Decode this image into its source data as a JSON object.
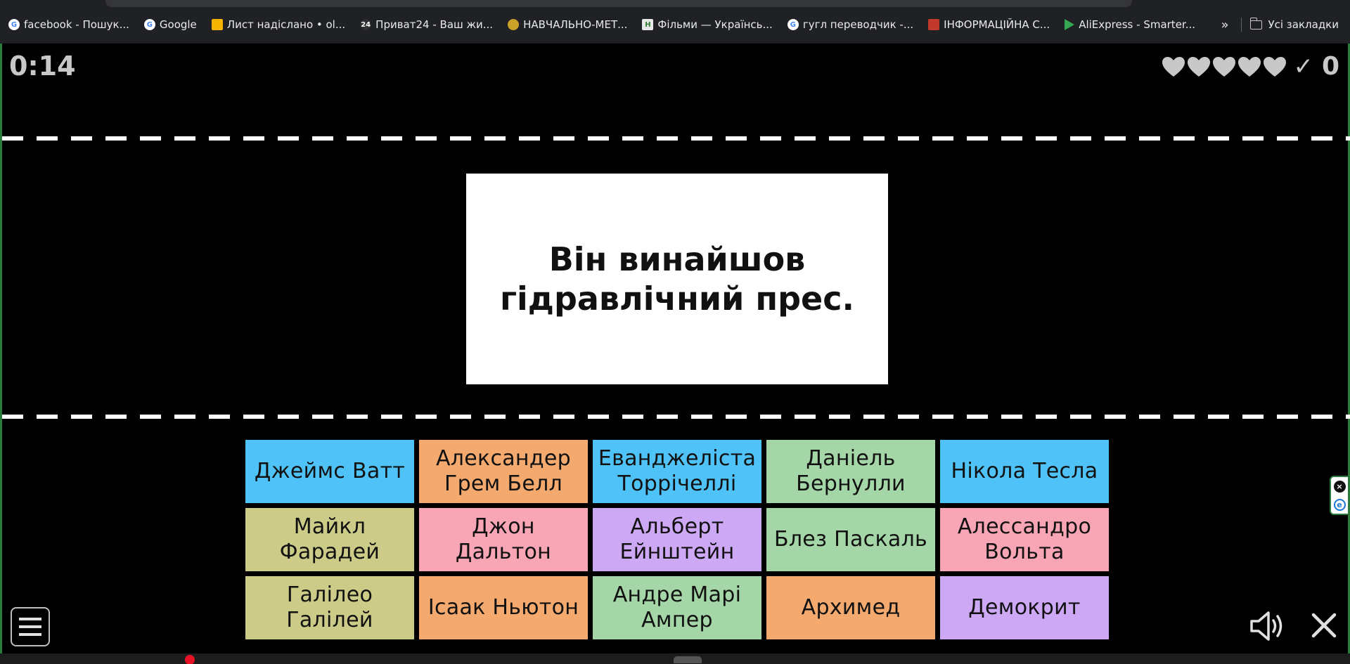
{
  "bookmarks": {
    "items": [
      {
        "label": "facebook - Пошук...",
        "icon": "google-icon",
        "color": "#4285f4"
      },
      {
        "label": "Google",
        "icon": "google-icon",
        "color": "#4285f4"
      },
      {
        "label": "Лист надіслано • ol...",
        "icon": "docs-icon",
        "color": "#f4b400"
      },
      {
        "label": "Приват24 - Ваш жи...",
        "icon": "privat24-icon",
        "color": "#2f2f2f"
      },
      {
        "label": "НАВЧАЛЬНО-МЕТ...",
        "icon": "emblem-icon",
        "color": "#c9a227"
      },
      {
        "label": "Фільми — Українсь...",
        "icon": "films-icon",
        "color": "#e8e8e8"
      },
      {
        "label": "гугл переводчик -...",
        "icon": "google-icon",
        "color": "#4285f4"
      },
      {
        "label": "ІНФОРМАЦІЙНА С...",
        "icon": "book-icon",
        "color": "#c0392b"
      },
      {
        "label": "AliExpress - Smarter...",
        "icon": "play-icon",
        "color": "#34a853"
      }
    ],
    "more": "»",
    "all_bookmarks": "Усі закладки"
  },
  "game": {
    "timer": "0:14",
    "lives": 5,
    "check": "✓",
    "score": "0",
    "question": "Він винайшов гідравлічний прес.",
    "answers": [
      {
        "label": "Джеймс Ватт",
        "color": "#4fc3f7"
      },
      {
        "label": "Александер Грем Белл",
        "color": "#f4a96e"
      },
      {
        "label": "Еванджеліста Торрічеллі",
        "color": "#4fc3f7"
      },
      {
        "label": "Даніель Бернулли",
        "color": "#a5d6a7"
      },
      {
        "label": "Нікола Тесла",
        "color": "#4fc3f7"
      },
      {
        "label": "Майкл Фарадей",
        "color": "#cccc88"
      },
      {
        "label": "Джон Дальтон",
        "color": "#f8a5b5"
      },
      {
        "label": "Альберт Ейнштейн",
        "color": "#cda8f5"
      },
      {
        "label": "Блез Паскаль",
        "color": "#a5d6a7"
      },
      {
        "label": "Алессандро Вольта",
        "color": "#f8a5b5"
      },
      {
        "label": "Галілео Галілей",
        "color": "#cccc88"
      },
      {
        "label": "Ісаак Ньютон",
        "color": "#f4a96e"
      },
      {
        "label": "Андре Марі Ампер",
        "color": "#a5d6a7"
      },
      {
        "label": "Архимед",
        "color": "#f4a96e"
      },
      {
        "label": "Демокрит",
        "color": "#cda8f5"
      }
    ]
  }
}
